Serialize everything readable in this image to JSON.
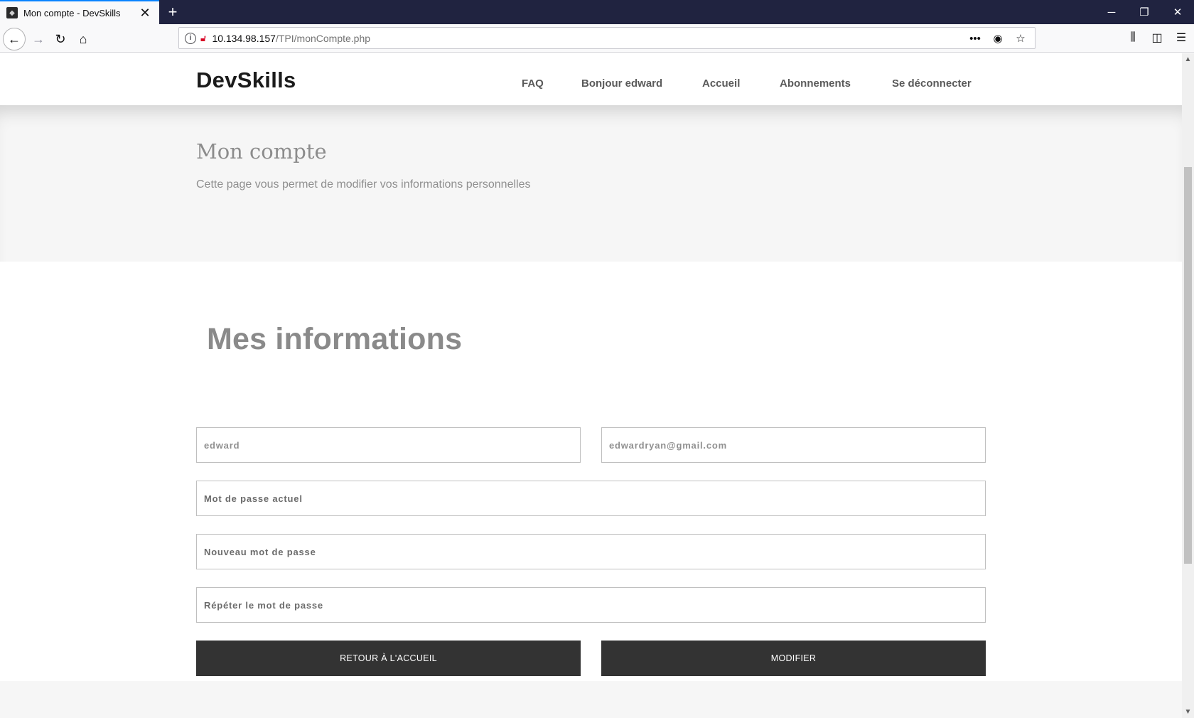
{
  "browser": {
    "tab_title": "Mon compte - DevSkills",
    "url_host": "10.134.98.157",
    "url_path": "/TPI/monCompte.php"
  },
  "header": {
    "brand": "DevSkills",
    "menu": [
      "FAQ",
      "Bonjour edward",
      "Accueil",
      "Abonnements",
      "Se déconnecter"
    ]
  },
  "hero": {
    "title": "Mon compte",
    "subtitle": "Cette page vous permet de modifier vos informations personnelles"
  },
  "form": {
    "title": "Mes informations",
    "username_value": "edward",
    "email_value": "edwardryan@gmail.com",
    "current_password_placeholder": "Mot de passe actuel",
    "new_password_placeholder": "Nouveau mot de passe",
    "repeat_password_placeholder": "Répéter le mot de passe",
    "back_button": "RETOUR À L'ACCUEIL",
    "submit_button": "MODIFIER"
  }
}
